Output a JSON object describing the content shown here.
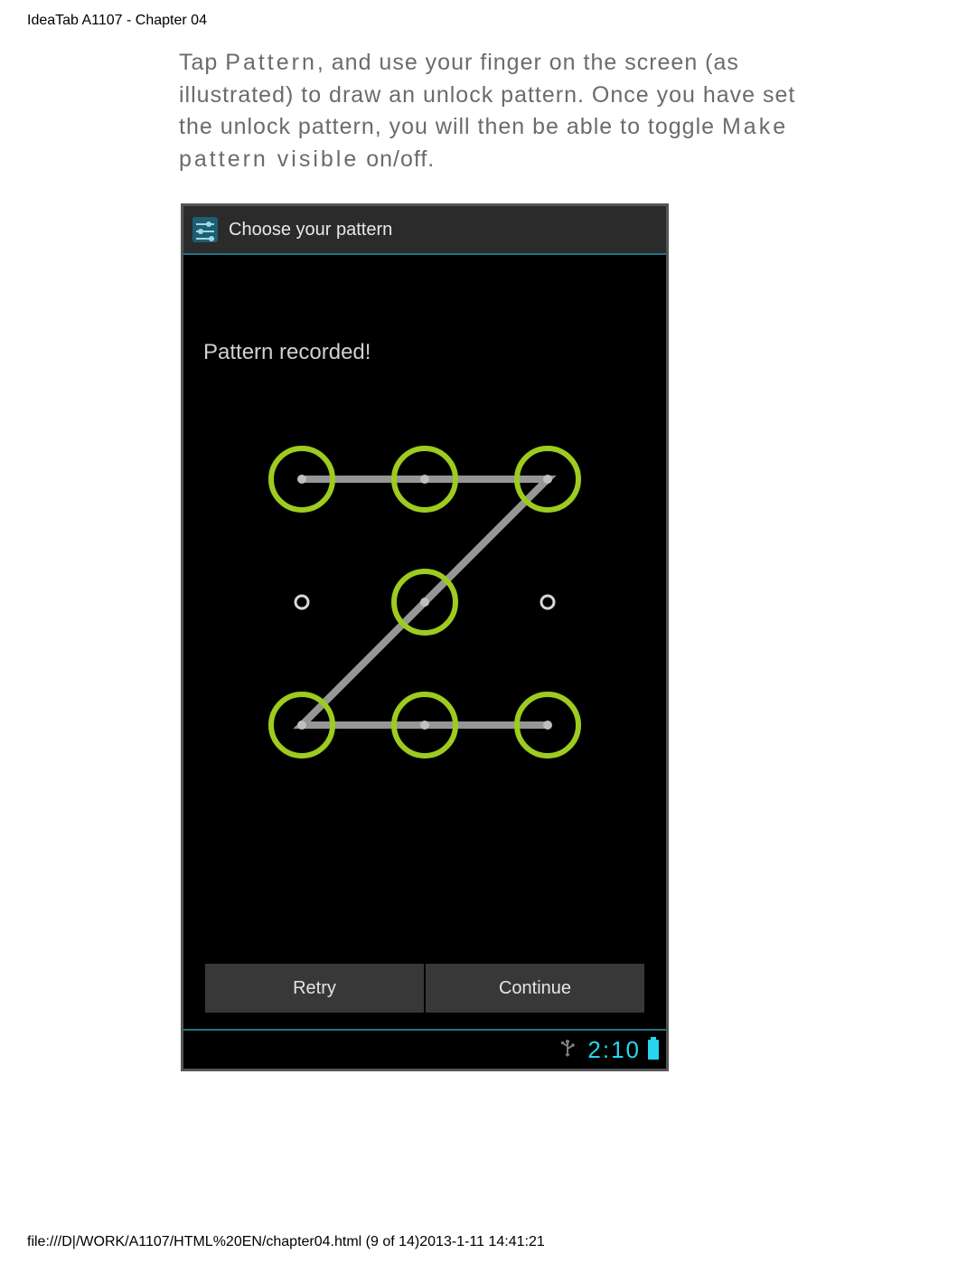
{
  "doc": {
    "header": "IdeaTab A1107 - Chapter 04",
    "footer": "file:///D|/WORK/A1107/HTML%20EN/chapter04.html (9 of 14)2013-1-11 14:41:21"
  },
  "instructions": {
    "pre1": "Tap ",
    "bold1": "Pattern",
    "mid": ", and use your finger on the screen (as illustrated) to draw an unlock pattern. Once you have set the unlock pattern, you will then be able to toggle ",
    "bold2": "Make pattern visible",
    "post": " on/off."
  },
  "device": {
    "title": "Choose your pattern",
    "status": "Pattern recorded!",
    "btn_retry": "Retry",
    "btn_continue": "Continue",
    "clock": "2:10"
  },
  "pattern": {
    "grid": 3,
    "selected": [
      0,
      1,
      2,
      4,
      6,
      7,
      8
    ],
    "path": [
      0,
      1,
      2,
      4,
      6,
      7,
      8
    ],
    "node_color_selected": "#9ecb1f",
    "node_color_idle": "#d8d8d8",
    "line_color": "#b0b0b0"
  }
}
